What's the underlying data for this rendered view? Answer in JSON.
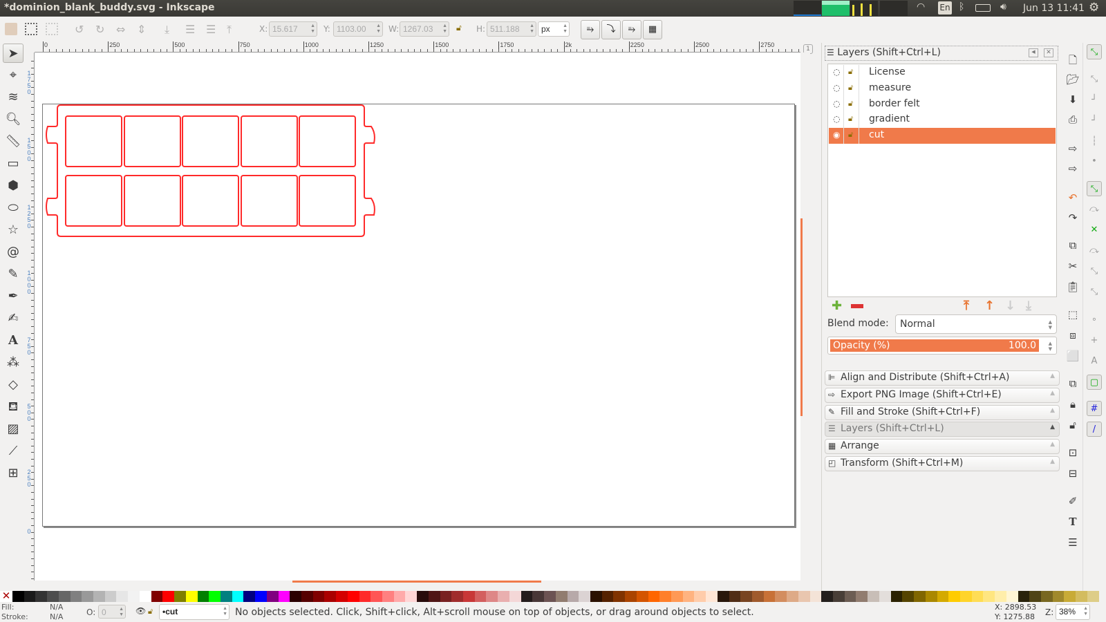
{
  "window": {
    "title": "*dominion_blank_buddy.svg - Inkscape"
  },
  "topbar": {
    "keyboard": "En",
    "datetime": "Jun 13 11:41",
    "icons": [
      "system-monitor-graph",
      "wifi-icon",
      "keyboard-layout-icon",
      "bluetooth-icon",
      "battery-icon",
      "volume-icon",
      "power-gear-icon"
    ]
  },
  "toolbar": {
    "x_label": "X:",
    "x": "15.617",
    "y_label": "Y:",
    "y": "1103.00",
    "w_label": "W:",
    "w": "1267.03",
    "h_label": "H:",
    "h": "511.188",
    "unit": "px"
  },
  "ruler": {
    "h_labels": [
      "0",
      "250",
      "500",
      "750",
      "1000",
      "1250",
      "1500",
      "1750",
      "2k",
      "2250",
      "2500",
      "2750"
    ],
    "v_labels": [
      "1750",
      "1500",
      "1250",
      "1000",
      "750",
      "500",
      "250",
      "0"
    ]
  },
  "tools": [
    "selector-tool",
    "node-tool",
    "tweak-tool",
    "zoom-tool",
    "measure-tool",
    "rectangle-tool",
    "3d-box-tool",
    "ellipse-tool",
    "star-tool",
    "spiral-tool",
    "pencil-tool",
    "pen-tool",
    "calligraphy-tool",
    "text-tool",
    "spray-tool",
    "eraser-tool",
    "paint-bucket-tool",
    "gradient-tool",
    "dropper-tool",
    "connector-tool"
  ],
  "layers_panel": {
    "title": "Layers (Shift+Ctrl+L)",
    "layers": [
      {
        "name": "License",
        "visible": false
      },
      {
        "name": "measure",
        "visible": false
      },
      {
        "name": "border felt",
        "visible": false
      },
      {
        "name": "gradient",
        "visible": false
      },
      {
        "name": "cut",
        "visible": true,
        "selected": true
      }
    ],
    "blend_label": "Blend mode:",
    "blend_value": "Normal",
    "opacity_label": "Opacity (%)",
    "opacity_value": "100.0"
  },
  "dialogs": [
    {
      "label": "Align and Distribute (Shift+Ctrl+A)",
      "icon": "align-icon"
    },
    {
      "label": "Export PNG Image (Shift+Ctrl+E)",
      "icon": "export-icon"
    },
    {
      "label": "Fill and Stroke (Shift+Ctrl+F)",
      "icon": "fill-stroke-icon"
    },
    {
      "label": "Layers (Shift+Ctrl+L)",
      "icon": "layers-icon"
    },
    {
      "label": "Arrange",
      "icon": "arrange-icon"
    },
    {
      "label": "Transform (Shift+Ctrl+M)",
      "icon": "transform-icon"
    }
  ],
  "commands": [
    "new-doc-icon",
    "open-icon",
    "save-icon",
    "print-icon",
    "import-icon",
    "export-icon",
    "undo-icon",
    "redo-icon",
    "copy-icon",
    "cut-icon",
    "paste-icon",
    "zoom-selection-icon",
    "zoom-drawing-icon",
    "zoom-page-icon",
    "duplicate-icon",
    "clone-icon",
    "unlink-clone-icon",
    "group-icon",
    "ungroup-icon",
    "xml-editor-icon",
    "text-font-icon",
    "layers-icon"
  ],
  "snaps": [
    "snap-toggle-icon",
    "snap-bbox-icon",
    "snap-bbox-edge-icon",
    "snap-bbox-corner-icon",
    "snap-bbox-midpoint-icon",
    "snap-bbox-center-icon",
    "snap-nodes-icon",
    "snap-path-icon",
    "snap-intersection-icon",
    "snap-cusp-icon",
    "snap-smooth-icon",
    "snap-midpoint-icon",
    "snap-object-center-icon",
    "snap-rotation-center-icon",
    "snap-text-baseline-icon",
    "snap-page-icon",
    "snap-grid-icon",
    "snap-guide-icon"
  ],
  "palette": [
    "#000000",
    "#1a1a1a",
    "#333333",
    "#4d4d4d",
    "#666666",
    "#808080",
    "#999999",
    "#b3b3b3",
    "#cccccc",
    "#e6e6e6",
    "#f2f2f2",
    "#ffffff",
    "#800000",
    "#ff0000",
    "#808000",
    "#ffff00",
    "#008000",
    "#00ff00",
    "#008080",
    "#00ffff",
    "#000080",
    "#0000ff",
    "#800080",
    "#ff00ff",
    "#2b0000",
    "#550000",
    "#800000",
    "#aa0000",
    "#d40000",
    "#ff0000",
    "#ff2a2a",
    "#ff5555",
    "#ff8080",
    "#ffaaaa",
    "#ffd5d5",
    "#280b0b",
    "#501616",
    "#782121",
    "#a02c2c",
    "#c83737",
    "#d35f5f",
    "#de8787",
    "#e9afaf",
    "#f4d7d7",
    "#241c1c",
    "#483737",
    "#6c5353",
    "#917c6f",
    "#b7a9a9",
    "#dbd3d3",
    "#2b1100",
    "#552200",
    "#803300",
    "#aa4400",
    "#d45500",
    "#ff6600",
    "#ff7f2a",
    "#ff9955",
    "#ffb380",
    "#ffccaa",
    "#ffe6d5",
    "#28170b",
    "#502d16",
    "#784421",
    "#a05a2c",
    "#c87137",
    "#d38d5f",
    "#deaa87",
    "#e9c6af",
    "#f4e3d7",
    "#241f1c",
    "#483e37",
    "#6c5d53",
    "#917c6f",
    "#c8beb7",
    "#e3dedb",
    "#2b2200",
    "#554400",
    "#806600",
    "#aa8800",
    "#d4aa00",
    "#ffcc00",
    "#ffd42a",
    "#ffdd55",
    "#ffe680",
    "#ffeeaa",
    "#fff6d5",
    "#28220b",
    "#504416",
    "#786721",
    "#a0892c",
    "#c8ab37",
    "#d3bc5f",
    "#decd87"
  ],
  "status": {
    "fill_label": "Fill:",
    "fill": "N/A",
    "stroke_label": "Stroke:",
    "stroke": "N/A",
    "opacity_label": "O:",
    "opacity": "0",
    "layer": "•cut",
    "message": "No objects selected. Click, Shift+click, Alt+scroll mouse on top of objects, or drag around objects to select.",
    "cursor_x": "X: 2898.53",
    "cursor_y": "Y: 1275.88",
    "zoom_label": "Z:",
    "zoom": "38%"
  },
  "colors": {
    "accent": "#f07a4a",
    "cut_stroke": "#ff2a2a",
    "topbar": "#3c3b37"
  }
}
